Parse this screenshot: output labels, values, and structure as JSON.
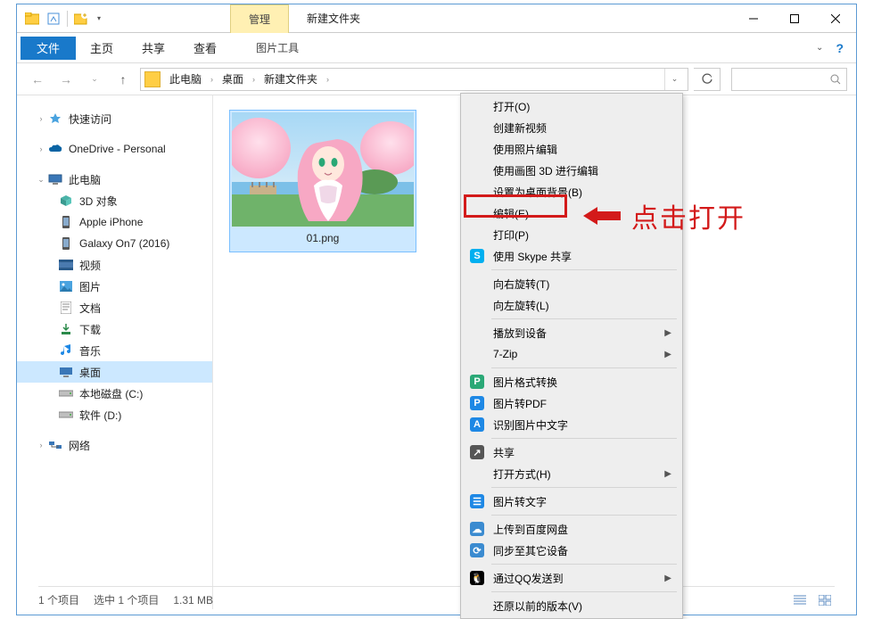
{
  "titlebar": {
    "manage_tab": "管理",
    "window_title": "新建文件夹"
  },
  "ribbon": {
    "file": "文件",
    "tabs": [
      "主页",
      "共享",
      "查看"
    ],
    "tools": "图片工具"
  },
  "breadcrumbs": [
    "此电脑",
    "桌面",
    "新建文件夹"
  ],
  "search": {
    "placeholder": ""
  },
  "navpane": {
    "quick_access": "快速访问",
    "onedrive": "OneDrive - Personal",
    "this_pc": "此电脑",
    "pc_children": [
      {
        "label": "3D 对象",
        "icon": "cube"
      },
      {
        "label": "Apple iPhone",
        "icon": "phone"
      },
      {
        "label": "Galaxy On7 (2016)",
        "icon": "phone"
      },
      {
        "label": "视频",
        "icon": "video"
      },
      {
        "label": "图片",
        "icon": "pictures"
      },
      {
        "label": "文档",
        "icon": "docs"
      },
      {
        "label": "下载",
        "icon": "downloads"
      },
      {
        "label": "音乐",
        "icon": "music"
      },
      {
        "label": "桌面",
        "icon": "desktop",
        "selected": true
      },
      {
        "label": "本地磁盘 (C:)",
        "icon": "drive"
      },
      {
        "label": "软件 (D:)",
        "icon": "drive"
      }
    ],
    "network": "网络"
  },
  "file_item": {
    "name": "01.png"
  },
  "context_menu": [
    {
      "label": "打开(O)"
    },
    {
      "label": "创建新视频"
    },
    {
      "label": "使用照片编辑"
    },
    {
      "label": "使用画图 3D 进行编辑"
    },
    {
      "label": "设置为桌面背景(B)"
    },
    {
      "label": "编辑(E)",
      "highlighted": true
    },
    {
      "label": "打印(P)"
    },
    {
      "label": "使用 Skype 共享",
      "icon": "S",
      "iconColor": "#00aff0"
    },
    {
      "sep": true
    },
    {
      "label": "向右旋转(T)"
    },
    {
      "label": "向左旋转(L)"
    },
    {
      "sep": true
    },
    {
      "label": "播放到设备",
      "submenu": true
    },
    {
      "label": "7-Zip",
      "submenu": true
    },
    {
      "sep": true
    },
    {
      "label": "图片格式转换",
      "icon": "P",
      "iconColor": "#2aa876"
    },
    {
      "label": "图片转PDF",
      "icon": "P",
      "iconColor": "#1e88e5"
    },
    {
      "label": "识别图片中文字",
      "icon": "A",
      "iconColor": "#1e88e5"
    },
    {
      "sep": true
    },
    {
      "label": "共享",
      "icon": "↗",
      "iconColor": "#555"
    },
    {
      "label": "打开方式(H)",
      "submenu": true
    },
    {
      "sep": true
    },
    {
      "label": "图片转文字",
      "icon": "☰",
      "iconColor": "#1e88e5"
    },
    {
      "sep": true
    },
    {
      "label": "上传到百度网盘",
      "icon": "☁",
      "iconColor": "#3b8bd0"
    },
    {
      "label": "同步至其它设备",
      "icon": "⟳",
      "iconColor": "#3b8bd0"
    },
    {
      "sep": true
    },
    {
      "label": "通过QQ发送到",
      "icon": "🐧",
      "iconColor": "#000",
      "submenu": true
    },
    {
      "sep": true
    },
    {
      "label": "还原以前的版本(V)"
    }
  ],
  "annotation": {
    "text": "点击打开"
  },
  "status": {
    "items": "1 个项目",
    "selected": "选中 1 个项目",
    "size": "1.31 MB"
  }
}
